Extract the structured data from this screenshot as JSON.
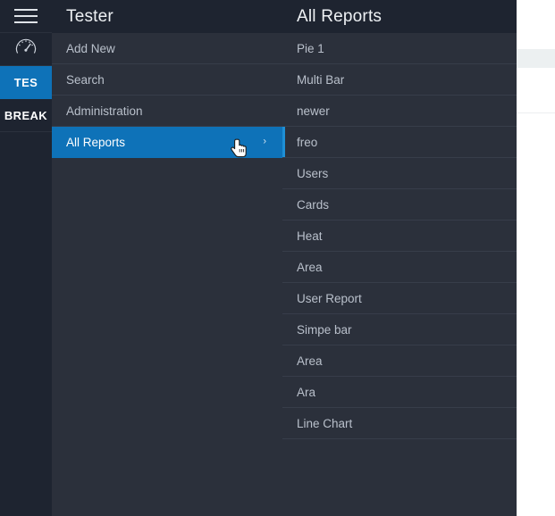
{
  "rail": {
    "items": [
      {
        "type": "icon",
        "icon": "hamburger-icon",
        "label": "",
        "active": false
      },
      {
        "type": "icon",
        "icon": "gauge-icon",
        "label": "",
        "active": false
      },
      {
        "type": "text",
        "icon": "",
        "label": "TES",
        "active": true
      },
      {
        "type": "text",
        "icon": "",
        "label": "BREAK",
        "active": false
      }
    ]
  },
  "middle_panel": {
    "title": "Tester",
    "items": [
      {
        "label": "Add New",
        "selected": false,
        "chevron": ""
      },
      {
        "label": "Search",
        "selected": false,
        "chevron": ""
      },
      {
        "label": "Administration",
        "selected": false,
        "chevron": ""
      },
      {
        "label": "All Reports",
        "selected": true,
        "chevron": "›"
      }
    ]
  },
  "right_panel": {
    "title": "All Reports",
    "items": [
      {
        "label": "Pie 1",
        "accent": false
      },
      {
        "label": "Multi Bar",
        "accent": false
      },
      {
        "label": "newer",
        "accent": false
      },
      {
        "label": "freo",
        "accent": true
      },
      {
        "label": "Users",
        "accent": false
      },
      {
        "label": "Cards",
        "accent": false
      },
      {
        "label": "Heat",
        "accent": false
      },
      {
        "label": "Area",
        "accent": false
      },
      {
        "label": "User Report",
        "accent": false
      },
      {
        "label": "Simpe bar",
        "accent": false
      },
      {
        "label": "Area",
        "accent": false
      },
      {
        "label": "Ara",
        "accent": false
      },
      {
        "label": "Line Chart",
        "accent": false
      }
    ]
  },
  "cursor": {
    "icon": "pointing-hand-cursor"
  },
  "colors": {
    "accent_blue": "#0e72b8",
    "accent_blue_bright": "#1e8fd5",
    "panel_bg": "#2b303b",
    "header_bg": "#1e2430",
    "divider": "#373d4a",
    "text_muted": "#b9c0cb",
    "page_band": "#ecf0f1"
  }
}
